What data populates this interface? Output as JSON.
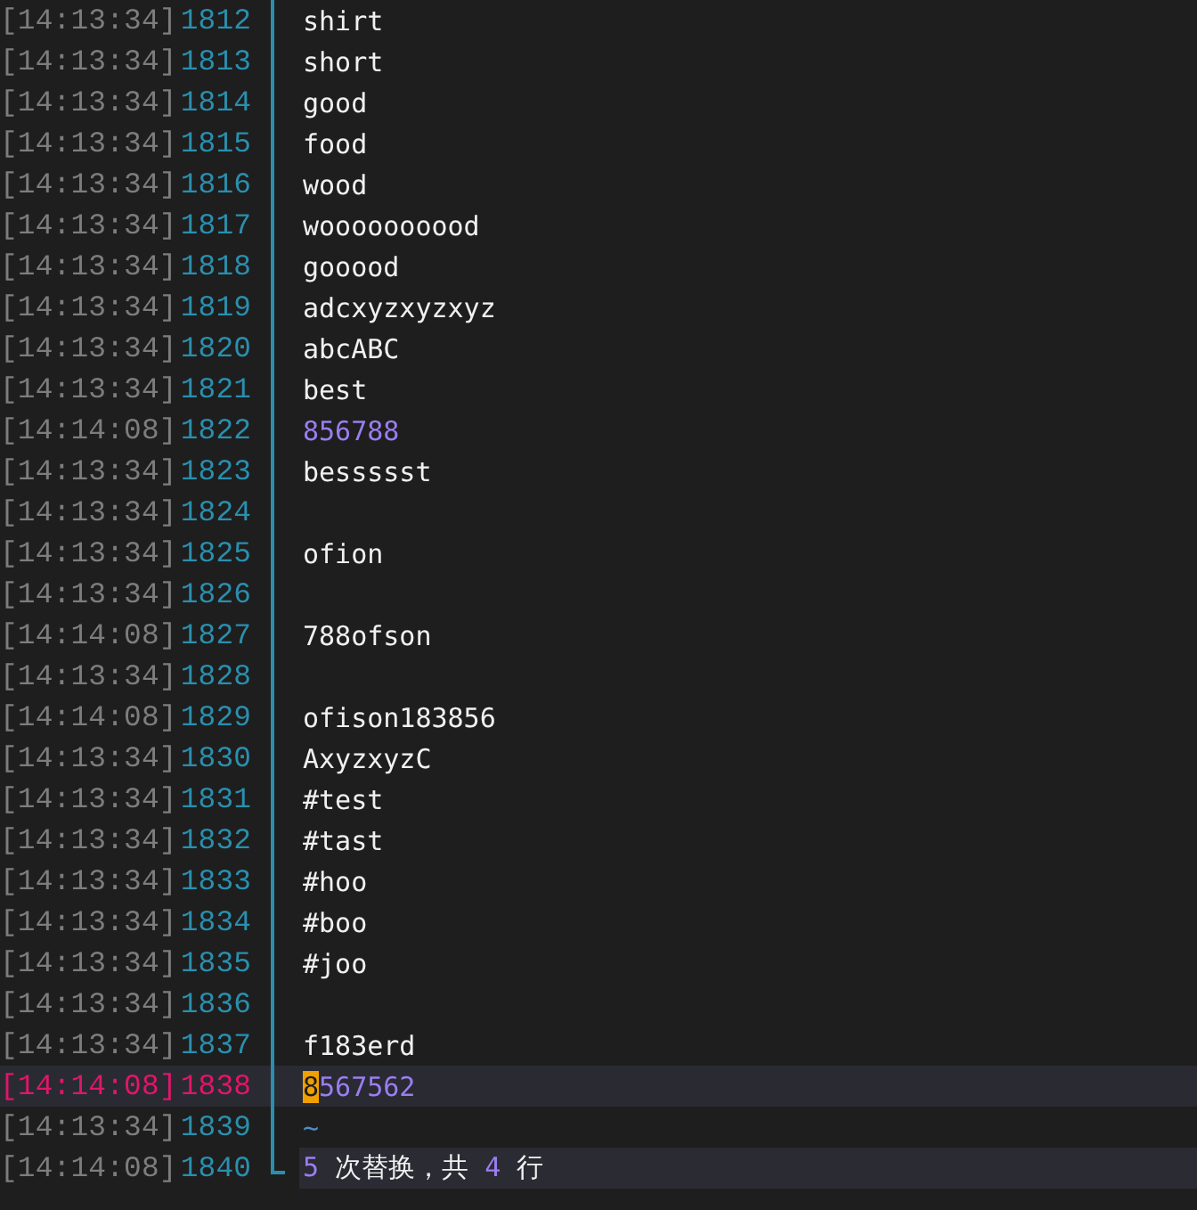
{
  "lines": [
    {
      "time": "[14:13:34]",
      "number": "1812",
      "kind": "text",
      "text": "shirt",
      "current": false
    },
    {
      "time": "[14:13:34]",
      "number": "1813",
      "kind": "text",
      "text": "short",
      "current": false
    },
    {
      "time": "[14:13:34]",
      "number": "1814",
      "kind": "text",
      "text": "good",
      "current": false
    },
    {
      "time": "[14:13:34]",
      "number": "1815",
      "kind": "text",
      "text": "food",
      "current": false
    },
    {
      "time": "[14:13:34]",
      "number": "1816",
      "kind": "text",
      "text": "wood",
      "current": false
    },
    {
      "time": "[14:13:34]",
      "number": "1817",
      "kind": "text",
      "text": "woooooooood",
      "current": false
    },
    {
      "time": "[14:13:34]",
      "number": "1818",
      "kind": "text",
      "text": "gooood",
      "current": false
    },
    {
      "time": "[14:13:34]",
      "number": "1819",
      "kind": "text",
      "text": "adcxyzxyzxyz",
      "current": false
    },
    {
      "time": "[14:13:34]",
      "number": "1820",
      "kind": "text",
      "text": "abcABC",
      "current": false
    },
    {
      "time": "[14:13:34]",
      "number": "1821",
      "kind": "text",
      "text": "best",
      "current": false
    },
    {
      "time": "[14:14:08]",
      "number": "1822",
      "kind": "number",
      "text": "856788",
      "current": false
    },
    {
      "time": "[14:13:34]",
      "number": "1823",
      "kind": "text",
      "text": "bessssst",
      "current": false
    },
    {
      "time": "[14:13:34]",
      "number": "1824",
      "kind": "empty",
      "current": false
    },
    {
      "time": "[14:13:34]",
      "number": "1825",
      "kind": "text",
      "text": "ofion",
      "current": false
    },
    {
      "time": "[14:13:34]",
      "number": "1826",
      "kind": "empty",
      "current": false
    },
    {
      "time": "[14:14:08]",
      "number": "1827",
      "kind": "text",
      "text": "788ofson",
      "current": false
    },
    {
      "time": "[14:13:34]",
      "number": "1828",
      "kind": "empty",
      "current": false
    },
    {
      "time": "[14:14:08]",
      "number": "1829",
      "kind": "text",
      "text": "ofison183856",
      "current": false
    },
    {
      "time": "[14:13:34]",
      "number": "1830",
      "kind": "text",
      "text": "AxyzxyzC",
      "current": false
    },
    {
      "time": "[14:13:34]",
      "number": "1831",
      "kind": "text",
      "text": "#test",
      "current": false
    },
    {
      "time": "[14:13:34]",
      "number": "1832",
      "kind": "text",
      "text": "#tast",
      "current": false
    },
    {
      "time": "[14:13:34]",
      "number": "1833",
      "kind": "text",
      "text": "#hoo",
      "current": false
    },
    {
      "time": "[14:13:34]",
      "number": "1834",
      "kind": "text",
      "text": "#boo",
      "current": false
    },
    {
      "time": "[14:13:34]",
      "number": "1835",
      "kind": "text",
      "text": "#joo",
      "current": false
    },
    {
      "time": "[14:13:34]",
      "number": "1836",
      "kind": "empty",
      "current": false
    },
    {
      "time": "[14:13:34]",
      "number": "1837",
      "kind": "text",
      "text": "f183erd",
      "current": false
    },
    {
      "time": "[14:14:08]",
      "number": "1838",
      "kind": "number",
      "text": "8567562",
      "current": true
    },
    {
      "time": "[14:13:34]",
      "number": "1839",
      "kind": "tilde",
      "text": "~",
      "current": false
    },
    {
      "time": "[14:14:08]",
      "number": "1840",
      "kind": "message",
      "current": false,
      "segments": [
        {
          "kind": "number",
          "text": "5"
        },
        {
          "kind": "text",
          "text": " 次替换，共 "
        },
        {
          "kind": "number",
          "text": "4"
        },
        {
          "kind": "text",
          "text": " 行"
        }
      ]
    }
  ]
}
